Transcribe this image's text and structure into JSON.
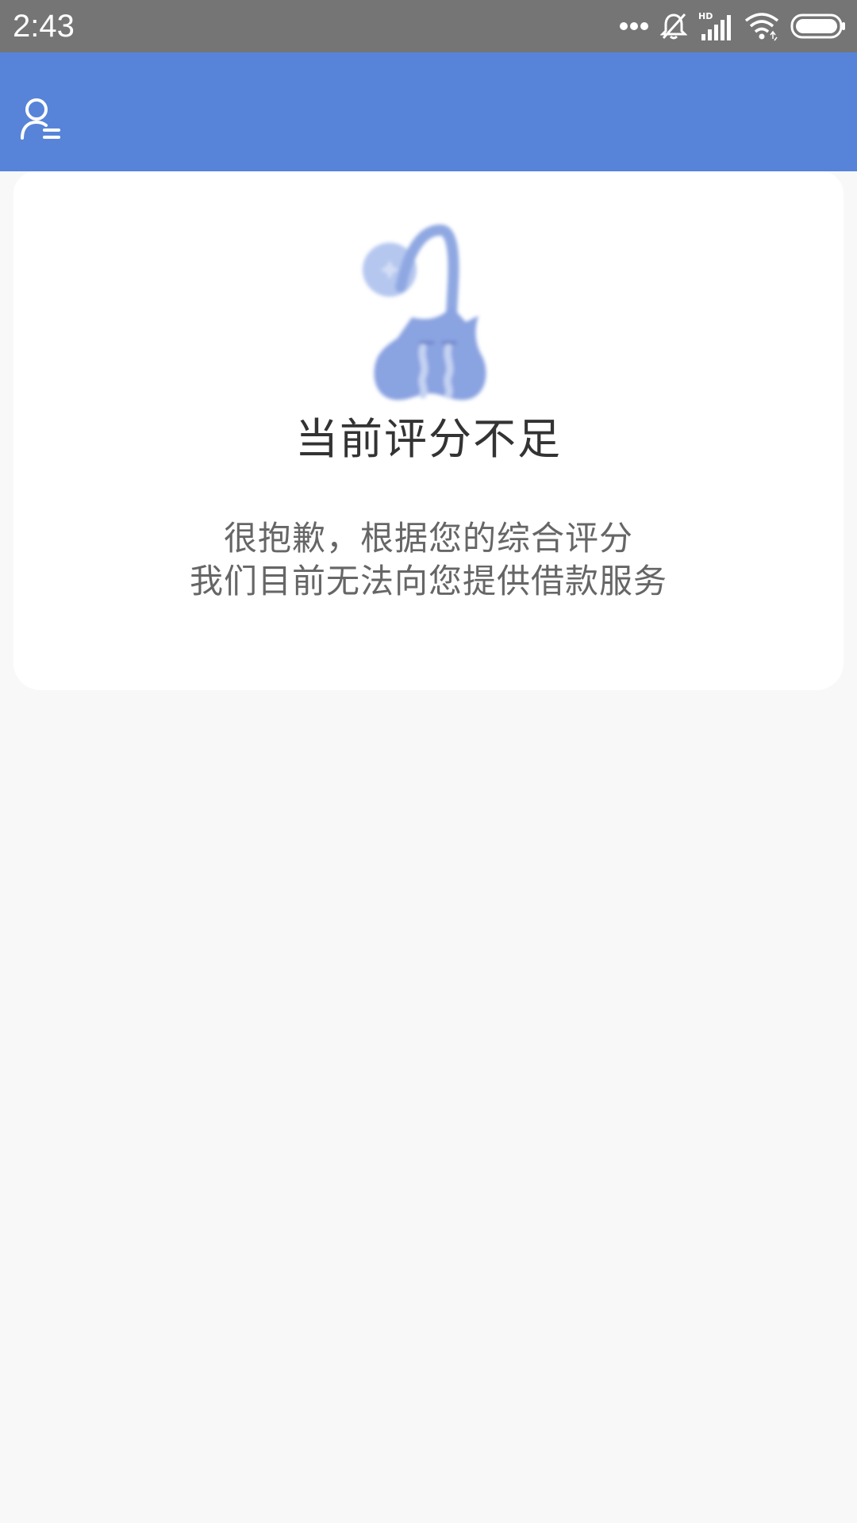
{
  "status_bar": {
    "time": "2:43",
    "icons": [
      "more-dots-icon",
      "bell-off-icon",
      "hd-signal-icon",
      "wifi-icon",
      "battery-icon"
    ],
    "background": "#757575"
  },
  "app_bar": {
    "background": "#5784d9",
    "icon": "profile-menu-icon"
  },
  "result": {
    "title": "当前评分不足",
    "message_line1": "很抱歉，根据您的综合评分",
    "message_line2": "我们目前无法向您提供借款服务",
    "illustration": "crying-money-bag-illustration",
    "accent": "#8aa3e1"
  }
}
